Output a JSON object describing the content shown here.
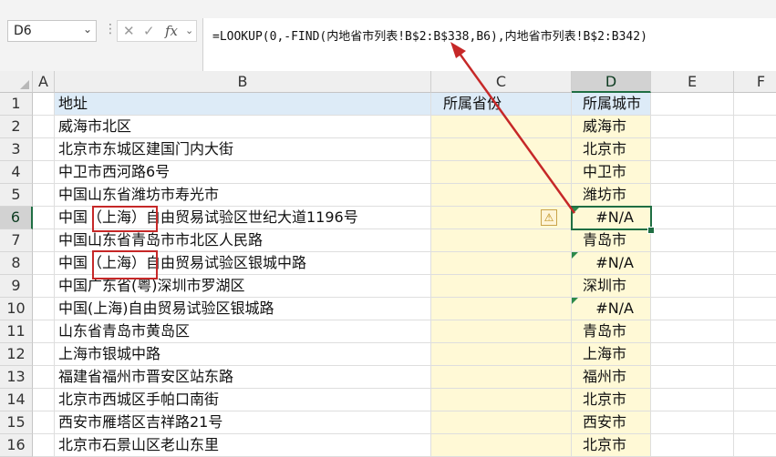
{
  "name_box": {
    "value": "D6"
  },
  "formula_bar": {
    "cancel_glyph": "✕",
    "enter_glyph": "✓",
    "fx_label": "fx",
    "formula": "=LOOKUP(0,-FIND(内地省市列表!B$2:B$338,B6),内地省市列表!B$2:B342)"
  },
  "columns": [
    "A",
    "B",
    "C",
    "D",
    "E",
    "F"
  ],
  "header_row": {
    "row": "1",
    "b": "地址",
    "c": "所属省份",
    "d": "所属城市"
  },
  "rows": [
    {
      "row": "2",
      "b": "威海市北区",
      "d": "威海市"
    },
    {
      "row": "3",
      "b": "北京市东城区建国门内大街",
      "d": "北京市"
    },
    {
      "row": "4",
      "b": "中卫市西河路6号",
      "d": "中卫市"
    },
    {
      "row": "5",
      "b": "中国山东省潍坊市寿光市",
      "d": "潍坊市"
    },
    {
      "row": "6",
      "b": "中国（上海）自由贸易试验区世纪大道1196号",
      "d": "#N/A"
    },
    {
      "row": "7",
      "b": "中国山东省青岛市市北区人民路",
      "d": "青岛市"
    },
    {
      "row": "8",
      "b": "中国（上海）自由贸易试验区银城中路",
      "d": "#N/A"
    },
    {
      "row": "9",
      "b": "中国广东省(粤)深圳市罗湖区",
      "d": "深圳市"
    },
    {
      "row": "10",
      "b": "中国(上海)自由贸易试验区银城路",
      "d": "#N/A"
    },
    {
      "row": "11",
      "b": "山东省青岛市黄岛区",
      "d": "青岛市"
    },
    {
      "row": "12",
      "b": "上海市银城中路",
      "d": "上海市"
    },
    {
      "row": "13",
      "b": "福建省福州市晋安区站东路",
      "d": "福州市"
    },
    {
      "row": "14",
      "b": "北京市西城区手帕口南街",
      "d": "北京市"
    },
    {
      "row": "15",
      "b": "西安市雁塔区吉祥路21号",
      "d": "西安市"
    },
    {
      "row": "16",
      "b": "北京市石景山区老山东里",
      "d": "北京市"
    }
  ],
  "selected_cell": "D6",
  "error_indicator_icon": "warning-icon",
  "colors": {
    "selection": "#1f6e43",
    "header_fill": "#ddebf7",
    "column_c_fill": "#fff9d6",
    "annotation_red": "#c62828",
    "error_triangle": "#2c8a4a"
  }
}
